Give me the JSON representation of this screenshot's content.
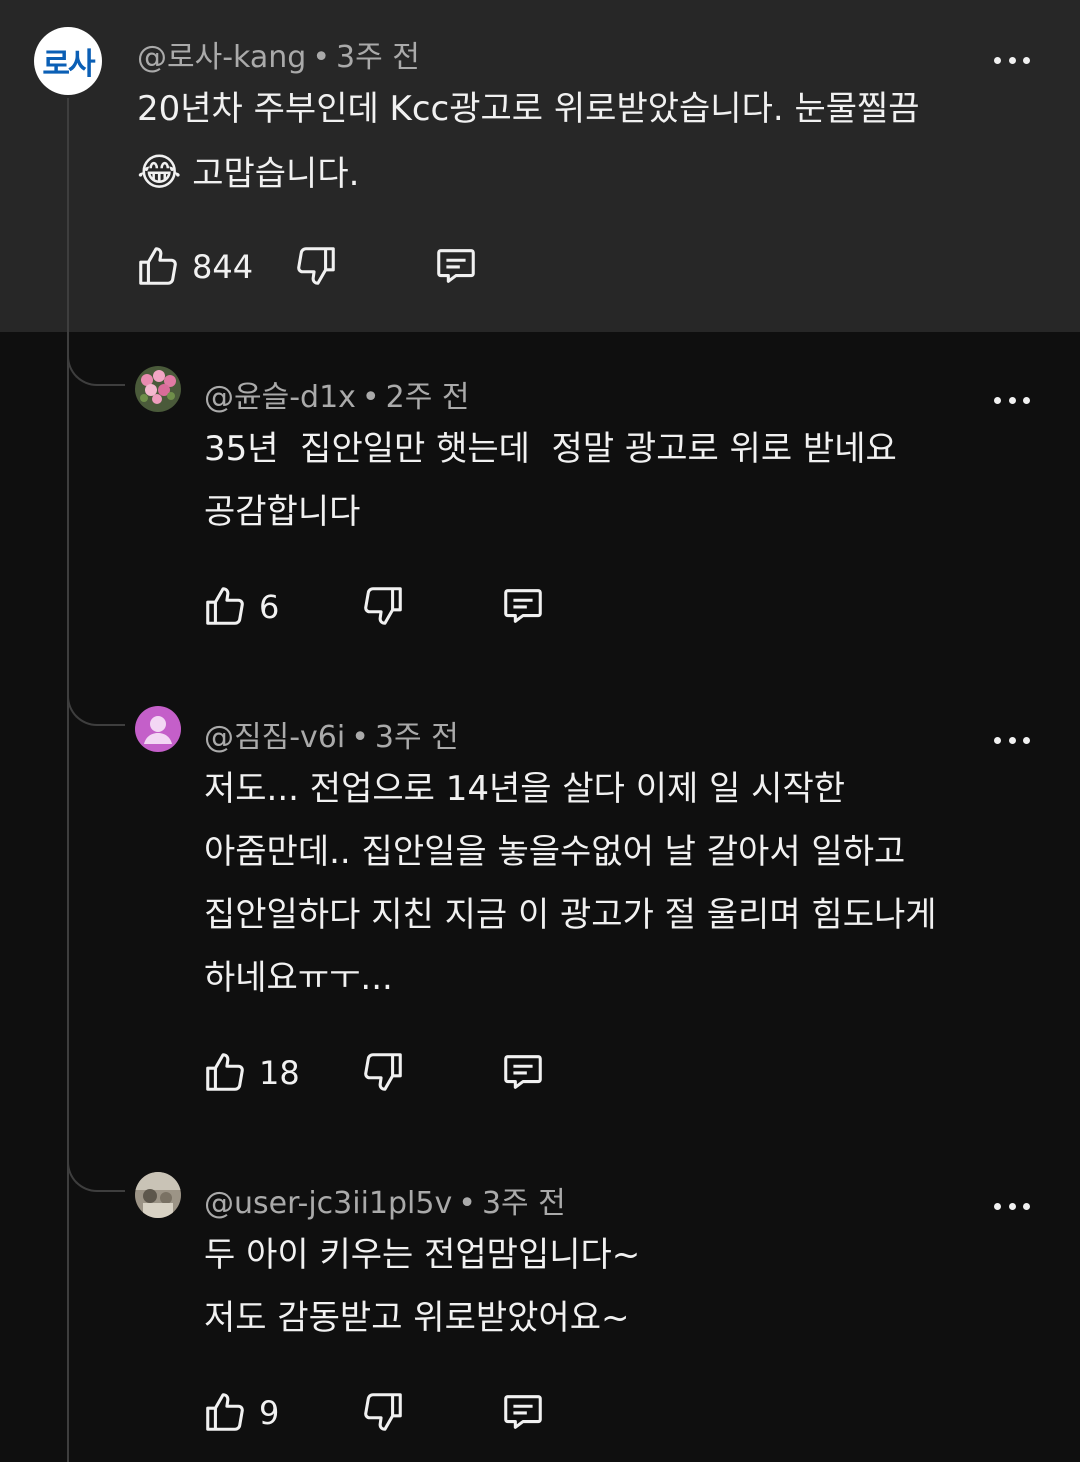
{
  "comments": [
    {
      "avatar_text": "로사",
      "handle": "@로사-kang",
      "time": "3주 전",
      "line1": "20년차 주부인데 Kcc광고로 위로받았습니다. 눈물찔끔",
      "line2_emoji": "😂",
      "line2": " 고맙습니다.",
      "likes": "844"
    },
    {
      "handle": "@윤슬-d1x",
      "time": "2주 전",
      "lines": [
        "35년  집안일만 햇는데  정말 광고로 위로 받네요",
        "공감합니다"
      ],
      "likes": "6"
    },
    {
      "handle": "@짐짐-v6i",
      "time": "3주 전",
      "lines": [
        "저도... 전업으로 14년을 살다 이제 일 시작한",
        "아줌만데.. 집안일을 놓을수없어 날 갈아서 일하고",
        "집안일하다 지친 지금 이 광고가 절 울리며 힘도나게",
        "하네요ㅠㅜ..."
      ],
      "likes": "18"
    },
    {
      "handle": "@user-jc3ii1pl5v",
      "time": "3주 전",
      "lines": [
        "두 아이 키우는 전업맘입니다~",
        "저도 감동받고 위로받았어요~"
      ],
      "likes": "9"
    }
  ],
  "icons": {
    "like": "thumbs-up-icon",
    "dislike": "thumbs-down-icon",
    "reply": "reply-icon",
    "more": "more-dots-icon"
  },
  "colors": {
    "background": "#0f0f0f",
    "highlight": "#272727",
    "text": "#f1f1f1",
    "meta": "#aaaaaa",
    "thread_line": "#3e3e3e"
  }
}
